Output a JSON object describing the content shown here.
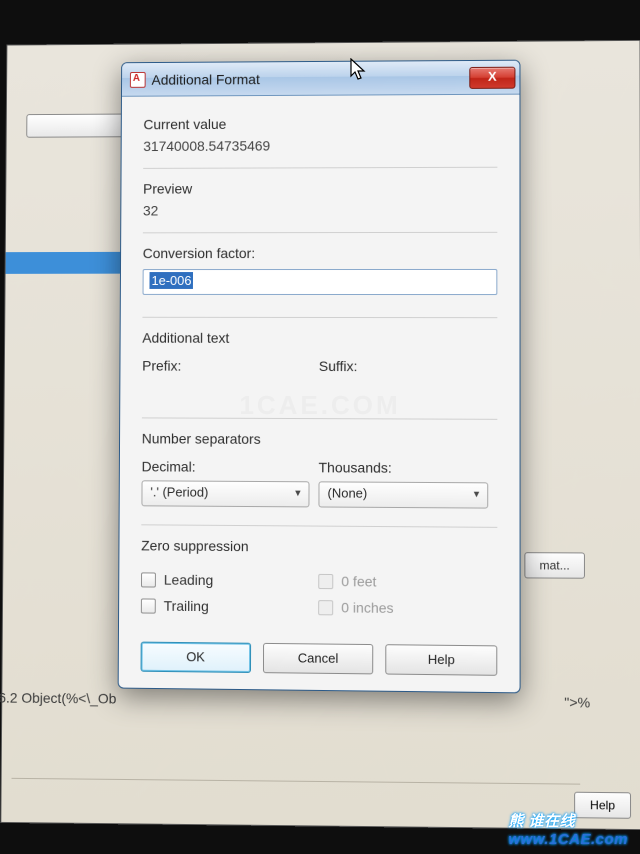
{
  "dialog": {
    "title": "Additional Format",
    "close_glyph": "X",
    "current_value_label": "Current value",
    "current_value": "31740008.54735469",
    "preview_label": "Preview",
    "preview_value": "32",
    "conversion_label": "Conversion factor:",
    "conversion_value": "1e-006",
    "additional_text_label": "Additional text",
    "prefix_label": "Prefix:",
    "suffix_label": "Suffix:",
    "separators_label": "Number separators",
    "decimal_label": "Decimal:",
    "thousands_label": "Thousands:",
    "decimal_value": "'.' (Period)",
    "thousands_value": "(None)",
    "zero_label": "Zero suppression",
    "leading_label": "Leading",
    "trailing_label": "Trailing",
    "feet_label": "0 feet",
    "inches_label": "0 inches",
    "ok": "OK",
    "cancel": "Cancel",
    "help": "Help"
  },
  "parent": {
    "format_btn": "mat...",
    "obj_text": "6.2 Object(%<\\_Ob",
    "obj_tail": "\">%",
    "help": "Help"
  },
  "watermark": {
    "center": "1CAE.COM",
    "corner_zh": "熊 谁在线",
    "corner_url": "www.1CAE.com"
  }
}
